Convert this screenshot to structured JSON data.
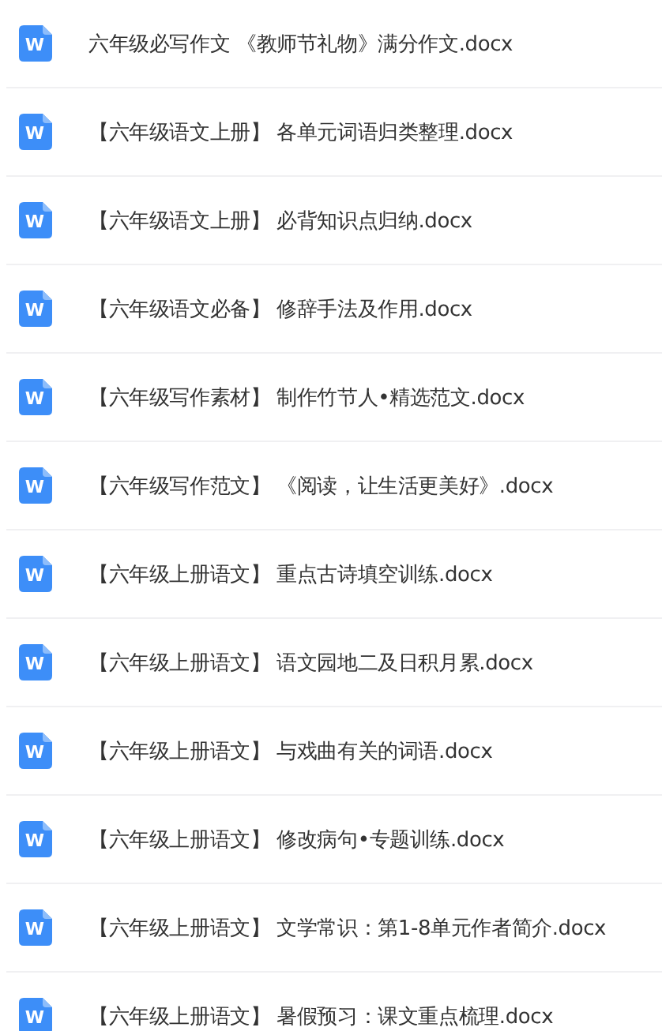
{
  "files": [
    {
      "icon_letter": "W",
      "name": "六年级必写作文 《教师节礼物》满分作文.docx"
    },
    {
      "icon_letter": "W",
      "name": "【六年级语文上册】 各单元词语归类整理.docx"
    },
    {
      "icon_letter": "W",
      "name": "【六年级语文上册】 必背知识点归纳.docx"
    },
    {
      "icon_letter": "W",
      "name": "【六年级语文必备】 修辞手法及作用.docx"
    },
    {
      "icon_letter": "W",
      "name": "【六年级写作素材】 制作竹节人•精选范文.docx"
    },
    {
      "icon_letter": "W",
      "name": "【六年级写作范文】 《阅读，让生活更美好》.docx"
    },
    {
      "icon_letter": "W",
      "name": "【六年级上册语文】 重点古诗填空训练.docx"
    },
    {
      "icon_letter": "W",
      "name": "【六年级上册语文】 语文园地二及日积月累.docx"
    },
    {
      "icon_letter": "W",
      "name": "【六年级上册语文】 与戏曲有关的词语.docx"
    },
    {
      "icon_letter": "W",
      "name": "【六年级上册语文】 修改病句•专题训练.docx"
    },
    {
      "icon_letter": "W",
      "name": "【六年级上册语文】 文学常识：第1-8单元作者简介.docx"
    },
    {
      "icon_letter": "W",
      "name": "【六年级上册语文】 暑假预习：课文重点梳理.docx"
    }
  ]
}
